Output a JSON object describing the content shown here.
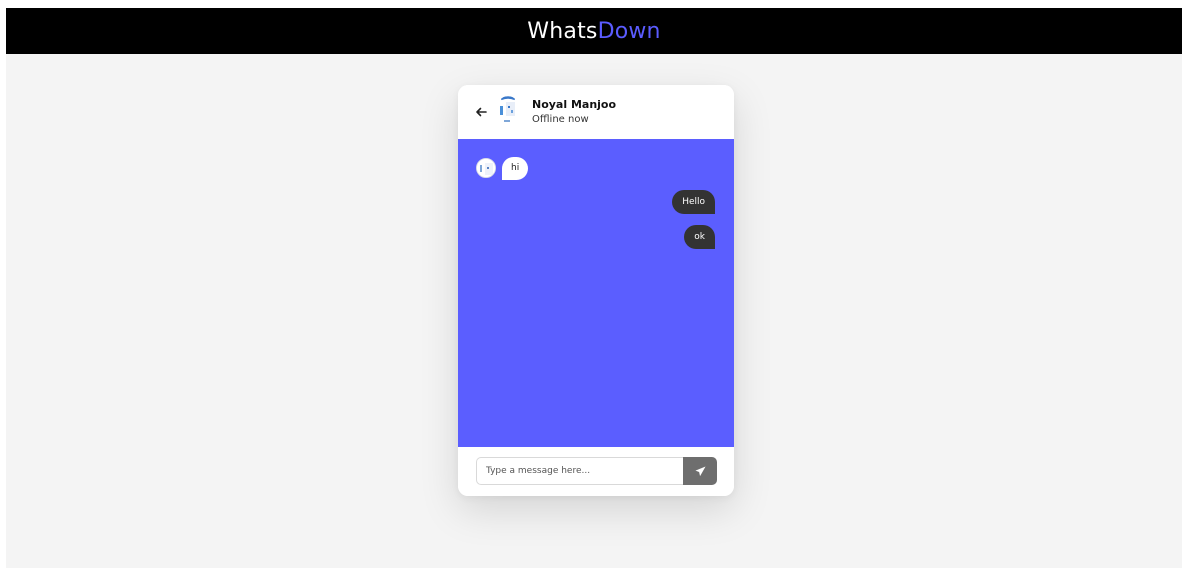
{
  "app": {
    "brand_primary": "Whats",
    "brand_accent": "Down",
    "accent_color": "#5b5cff"
  },
  "chat": {
    "back_icon": "arrow-left-icon",
    "user_name": "Noyal Manjoo",
    "status": "Offline now",
    "body_color": "#5b5eff",
    "messages": [
      {
        "direction": "incoming",
        "text": "hi"
      },
      {
        "direction": "outgoing",
        "text": "Hello"
      },
      {
        "direction": "outgoing",
        "text": "ok"
      }
    ],
    "input": {
      "placeholder": "Type a message here...",
      "value": ""
    },
    "send_icon": "paper-plane-icon"
  }
}
